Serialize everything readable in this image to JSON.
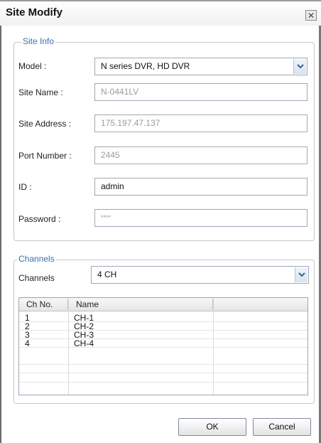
{
  "window": {
    "title": "Site Modify",
    "close_glyph": "✕"
  },
  "site_info": {
    "legend": "Site Info",
    "model": {
      "label": "Model :",
      "value": "N series DVR, HD DVR"
    },
    "site_name": {
      "label": "Site Name :",
      "value": "N-0441LV"
    },
    "site_address": {
      "label": "Site Address :",
      "value": "175.197.47.137"
    },
    "port_number": {
      "label": "Port Number :",
      "value": "2445"
    },
    "id": {
      "label": "ID :",
      "value": "admin"
    },
    "password": {
      "label": "Password :",
      "value": "****"
    }
  },
  "channels": {
    "legend": "Channels",
    "label": "Channels",
    "value": "4 CH",
    "columns": [
      "Ch No.",
      "Name"
    ],
    "rows": [
      {
        "no": "1",
        "name": "CH-1"
      },
      {
        "no": "2",
        "name": "CH-2"
      },
      {
        "no": "3",
        "name": "CH-3"
      },
      {
        "no": "4",
        "name": "CH-4"
      }
    ]
  },
  "buttons": {
    "ok": "OK",
    "cancel": "Cancel"
  },
  "icons": {
    "dropdown": "chevron-down-icon",
    "close": "close-icon"
  }
}
